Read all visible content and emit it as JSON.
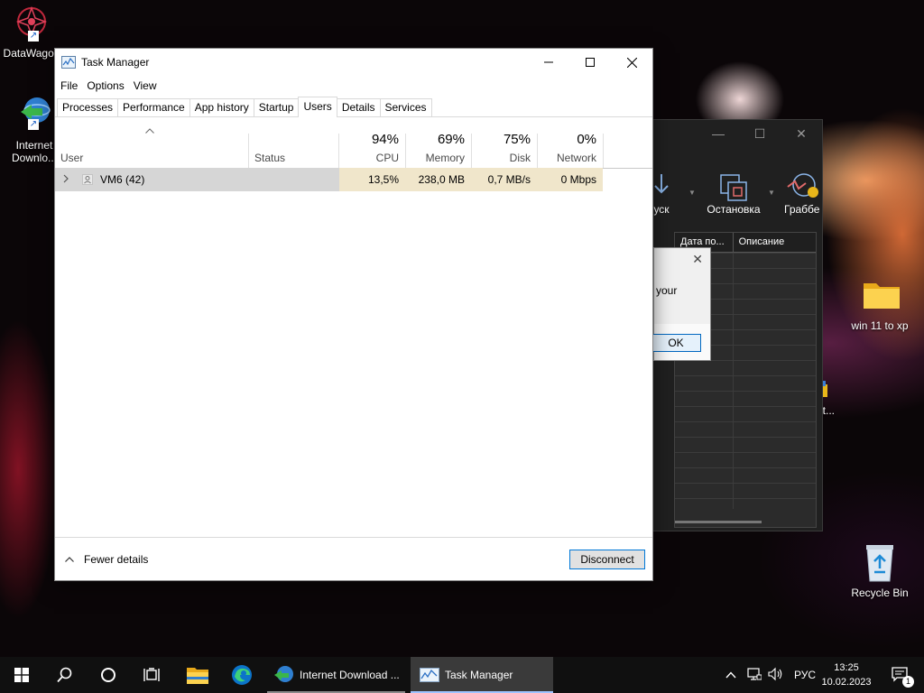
{
  "desktop": {
    "icons": [
      {
        "label": "DataWagon",
        "icon": "datawagon-icon"
      },
      {
        "label": "Internet Downlo...",
        "icon": "internet-download-manager-icon"
      },
      {
        "label": "win 11 to xp",
        "icon": "folder-icon"
      },
      {
        "label": "Recycle Bin",
        "icon": "recycle-bin-icon"
      },
      {
        "label": "at...",
        "icon": "partial-icon"
      }
    ]
  },
  "background_window": {
    "tools": [
      {
        "label": "уск",
        "icon": "start-icon"
      },
      {
        "label": "Остановка",
        "icon": "stop-icon"
      },
      {
        "label": "Граббе",
        "icon": "grabber-icon"
      }
    ],
    "columns": [
      "Дата по...",
      "Описание"
    ],
    "dialog": {
      "text": "your",
      "ok_label": "OK"
    }
  },
  "task_manager": {
    "title": "Task Manager",
    "menu": [
      "File",
      "Options",
      "View"
    ],
    "tabs": [
      "Processes",
      "Performance",
      "App history",
      "Startup",
      "Users",
      "Details",
      "Services"
    ],
    "active_tab": "Users",
    "columns": {
      "user": "User",
      "status": "Status",
      "cpu": {
        "pct": "94%",
        "label": "CPU"
      },
      "memory": {
        "pct": "69%",
        "label": "Memory"
      },
      "disk": {
        "pct": "75%",
        "label": "Disk"
      },
      "network": {
        "pct": "0%",
        "label": "Network"
      }
    },
    "rows": [
      {
        "user": "VM6 (42)",
        "status": "",
        "cpu": "13,5%",
        "memory": "238,0 MB",
        "disk": "0,7 MB/s",
        "network": "0 Mbps"
      }
    ],
    "fewer_details": "Fewer details",
    "disconnect": "Disconnect"
  },
  "taskbar": {
    "apps": [
      {
        "label": "Internet Download ...",
        "icon": "internet-download-manager-icon"
      },
      {
        "label": "Task Manager",
        "icon": "task-manager-icon"
      }
    ],
    "language": "РУС",
    "time": "13:25",
    "date": "10.02.2023",
    "notification_count": "1"
  }
}
